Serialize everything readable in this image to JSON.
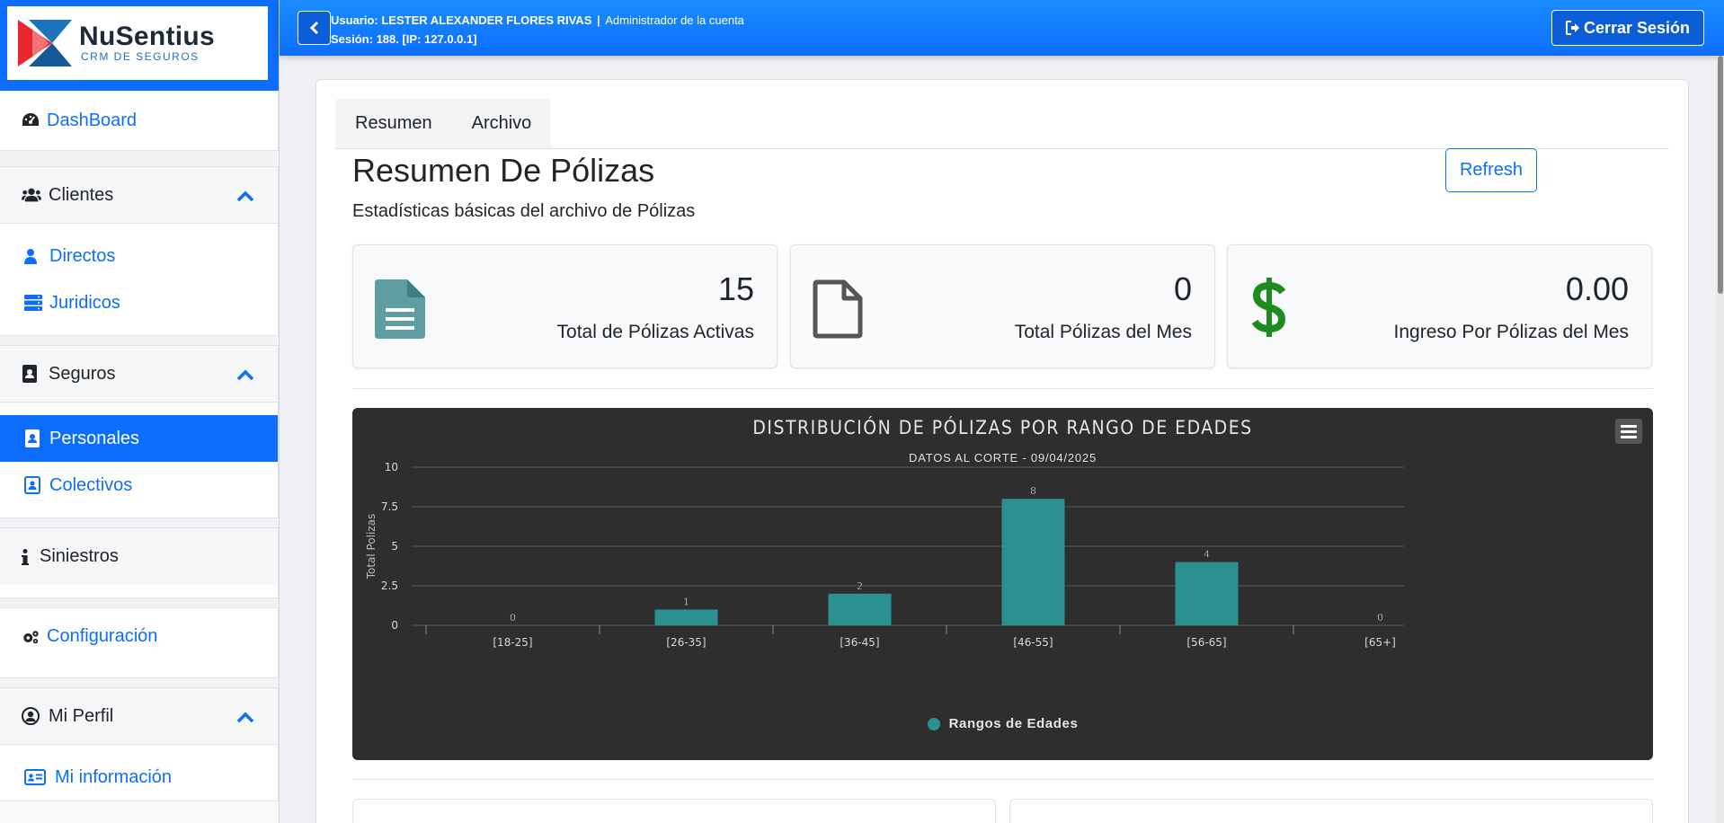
{
  "sidebar": {
    "logo": {
      "brand": "NuSentius",
      "tagline": "CRM DE SEGUROS"
    },
    "dashboard": "DashBoard",
    "clientes": {
      "label": "Clientes",
      "items": [
        "Directos",
        "Juridicos"
      ]
    },
    "seguros": {
      "label": "Seguros",
      "items": [
        "Personales",
        "Colectivos"
      ]
    },
    "siniestros": "Siniestros",
    "configuracion": "Configuración",
    "perfil": {
      "label": "Mi Perfil",
      "items": [
        "Mi información"
      ]
    }
  },
  "topbar": {
    "user_line": "Usuario: LESTER ALEXANDER FLORES RIVAS",
    "separator": "|",
    "role": "Administrador de la cuenta",
    "session_line": "Sesión: 188. [IP: 127.0.0.1]",
    "logout": "Cerrar Sesión"
  },
  "tabs": [
    "Resumen",
    "Archivo"
  ],
  "page": {
    "title": "Resumen De Pólizas",
    "subtitle": "Estadísticas básicas del archivo de Pólizas",
    "refresh": "Refresh"
  },
  "stats": [
    {
      "value": "15",
      "label": "Total de Pólizas Activas",
      "icon": "file-text-icon",
      "color": "#5f9ea0"
    },
    {
      "value": "0",
      "label": "Total Pólizas del Mes",
      "icon": "file-outline-icon",
      "color": "#555555"
    },
    {
      "value": "0.00",
      "label": "Ingreso Por Pólizas del Mes",
      "icon": "dollar-icon",
      "color": "#1e8b1e"
    }
  ],
  "chart_data": {
    "type": "bar",
    "title": "Distribución de Pólizas por Rango de Edades",
    "subtitle": "Datos al corte - 09/04/2025",
    "ylabel": "Total Polizas",
    "categories": [
      "[18-25]",
      "[26-35]",
      "[36-45]",
      "[46-55]",
      "[56-65]",
      "[65+]"
    ],
    "series": [
      {
        "name": "Rangos de Edades",
        "values": [
          0,
          1,
          2,
          8,
          4,
          0
        ],
        "color": "#2a9090"
      }
    ],
    "yticks": [
      "0",
      "2.5",
      "5",
      "7.5",
      "10"
    ],
    "ylim": [
      0,
      10
    ],
    "legend": "bottom-center",
    "background": "#2e2e2e"
  }
}
